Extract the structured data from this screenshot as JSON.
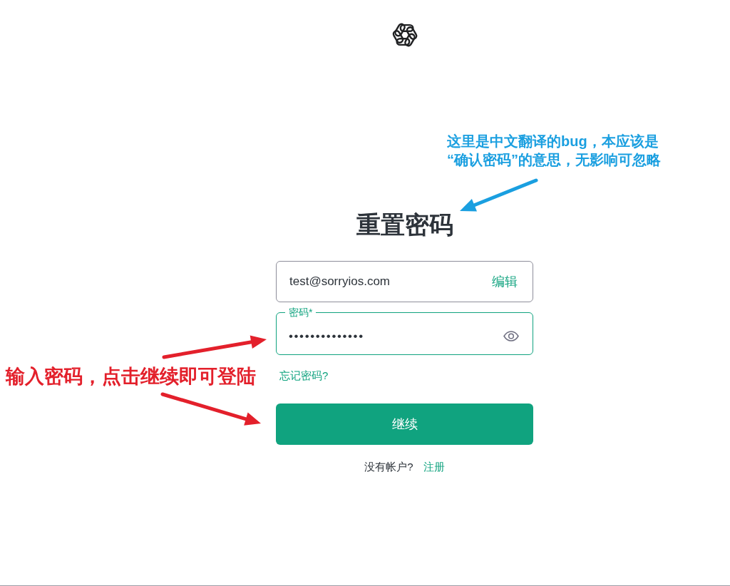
{
  "heading": "重置密码",
  "email_field": {
    "value": "test@sorryios.com",
    "edit_link": "编辑",
    "focused": false
  },
  "password_field": {
    "label": "密码*",
    "value": "••••••••••••••",
    "focused": true
  },
  "forgot_password_link": "忘记密码?",
  "continue_button": "继续",
  "signup": {
    "prompt": "没有帐户?",
    "link": "注册"
  },
  "annotations": [
    {
      "kind": "note",
      "color": "#1a9fe0",
      "lines": [
        "这里是中文翻译的bug，本应该是",
        "“确认密码”的意思，无影响可忽略"
      ]
    },
    {
      "kind": "note",
      "color": "#e3202b",
      "lines": [
        "输入密码，点击继续即可登陆"
      ]
    }
  ]
}
